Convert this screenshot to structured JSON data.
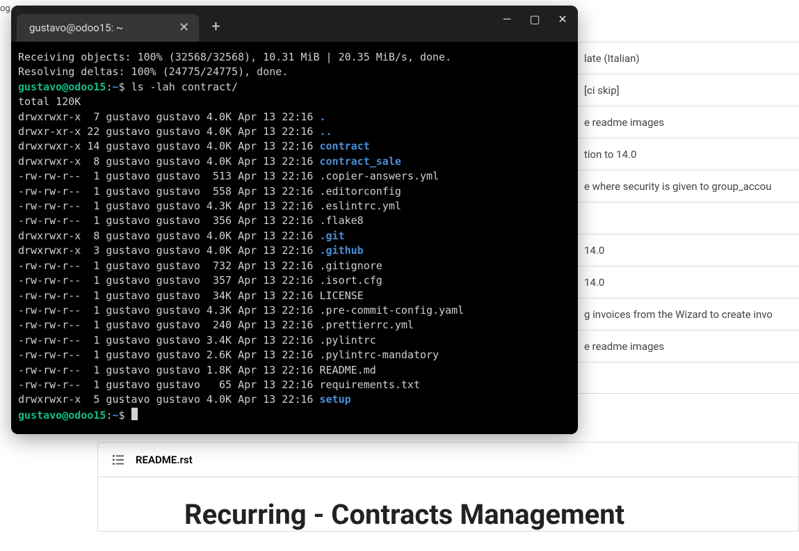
{
  "background": {
    "left_fragment": "og",
    "rows": [
      "late (Italian)",
      "[ci skip]",
      "e readme images",
      "tion to 14.0",
      "e where security is given to group_accou",
      "",
      "14.0",
      "14.0",
      "g invoices from the Wizard to create invo",
      "e readme images",
      ""
    ]
  },
  "readme": {
    "filename": "README.rst",
    "title": "Recurring - Contracts Management"
  },
  "terminal": {
    "tab_title": "gustavo@odoo15: ~",
    "output": {
      "line1": "Receiving objects: 100% (32568/32568), 10.31 MiB | 20.35 MiB/s, done.",
      "line2": "Resolving deltas: 100% (24775/24775), done.",
      "prompt_user": "gustavo@odoo15",
      "prompt_path": "~",
      "prompt_symbol": "$",
      "cmd1": "ls -lah contract/",
      "total": "total 120K",
      "entries": [
        {
          "perm": "drwxrwxr-x",
          "links": " 7",
          "owner": "gustavo",
          "group": "gustavo",
          "size": "4.0K",
          "date": "Apr 13 22:16",
          "name": ".",
          "dir": true
        },
        {
          "perm": "drwxr-xr-x",
          "links": "22",
          "owner": "gustavo",
          "group": "gustavo",
          "size": "4.0K",
          "date": "Apr 13 22:16",
          "name": "..",
          "dir": true
        },
        {
          "perm": "drwxrwxr-x",
          "links": "14",
          "owner": "gustavo",
          "group": "gustavo",
          "size": "4.0K",
          "date": "Apr 13 22:16",
          "name": "contract",
          "dir": true
        },
        {
          "perm": "drwxrwxr-x",
          "links": " 8",
          "owner": "gustavo",
          "group": "gustavo",
          "size": "4.0K",
          "date": "Apr 13 22:16",
          "name": "contract_sale",
          "dir": true
        },
        {
          "perm": "-rw-rw-r--",
          "links": " 1",
          "owner": "gustavo",
          "group": "gustavo",
          "size": " 513",
          "date": "Apr 13 22:16",
          "name": ".copier-answers.yml",
          "dir": false
        },
        {
          "perm": "-rw-rw-r--",
          "links": " 1",
          "owner": "gustavo",
          "group": "gustavo",
          "size": " 558",
          "date": "Apr 13 22:16",
          "name": ".editorconfig",
          "dir": false
        },
        {
          "perm": "-rw-rw-r--",
          "links": " 1",
          "owner": "gustavo",
          "group": "gustavo",
          "size": "4.3K",
          "date": "Apr 13 22:16",
          "name": ".eslintrc.yml",
          "dir": false
        },
        {
          "perm": "-rw-rw-r--",
          "links": " 1",
          "owner": "gustavo",
          "group": "gustavo",
          "size": " 356",
          "date": "Apr 13 22:16",
          "name": ".flake8",
          "dir": false
        },
        {
          "perm": "drwxrwxr-x",
          "links": " 8",
          "owner": "gustavo",
          "group": "gustavo",
          "size": "4.0K",
          "date": "Apr 13 22:16",
          "name": ".git",
          "dir": true
        },
        {
          "perm": "drwxrwxr-x",
          "links": " 3",
          "owner": "gustavo",
          "group": "gustavo",
          "size": "4.0K",
          "date": "Apr 13 22:16",
          "name": ".github",
          "dir": true
        },
        {
          "perm": "-rw-rw-r--",
          "links": " 1",
          "owner": "gustavo",
          "group": "gustavo",
          "size": " 732",
          "date": "Apr 13 22:16",
          "name": ".gitignore",
          "dir": false
        },
        {
          "perm": "-rw-rw-r--",
          "links": " 1",
          "owner": "gustavo",
          "group": "gustavo",
          "size": " 357",
          "date": "Apr 13 22:16",
          "name": ".isort.cfg",
          "dir": false
        },
        {
          "perm": "-rw-rw-r--",
          "links": " 1",
          "owner": "gustavo",
          "group": "gustavo",
          "size": " 34K",
          "date": "Apr 13 22:16",
          "name": "LICENSE",
          "dir": false
        },
        {
          "perm": "-rw-rw-r--",
          "links": " 1",
          "owner": "gustavo",
          "group": "gustavo",
          "size": "4.3K",
          "date": "Apr 13 22:16",
          "name": ".pre-commit-config.yaml",
          "dir": false
        },
        {
          "perm": "-rw-rw-r--",
          "links": " 1",
          "owner": "gustavo",
          "group": "gustavo",
          "size": " 240",
          "date": "Apr 13 22:16",
          "name": ".prettierrc.yml",
          "dir": false
        },
        {
          "perm": "-rw-rw-r--",
          "links": " 1",
          "owner": "gustavo",
          "group": "gustavo",
          "size": "3.4K",
          "date": "Apr 13 22:16",
          "name": ".pylintrc",
          "dir": false
        },
        {
          "perm": "-rw-rw-r--",
          "links": " 1",
          "owner": "gustavo",
          "group": "gustavo",
          "size": "2.6K",
          "date": "Apr 13 22:16",
          "name": ".pylintrc-mandatory",
          "dir": false
        },
        {
          "perm": "-rw-rw-r--",
          "links": " 1",
          "owner": "gustavo",
          "group": "gustavo",
          "size": "1.8K",
          "date": "Apr 13 22:16",
          "name": "README.md",
          "dir": false
        },
        {
          "perm": "-rw-rw-r--",
          "links": " 1",
          "owner": "gustavo",
          "group": "gustavo",
          "size": "  65",
          "date": "Apr 13 22:16",
          "name": "requirements.txt",
          "dir": false
        },
        {
          "perm": "drwxrwxr-x",
          "links": " 5",
          "owner": "gustavo",
          "group": "gustavo",
          "size": "4.0K",
          "date": "Apr 13 22:16",
          "name": "setup",
          "dir": true
        }
      ]
    }
  }
}
